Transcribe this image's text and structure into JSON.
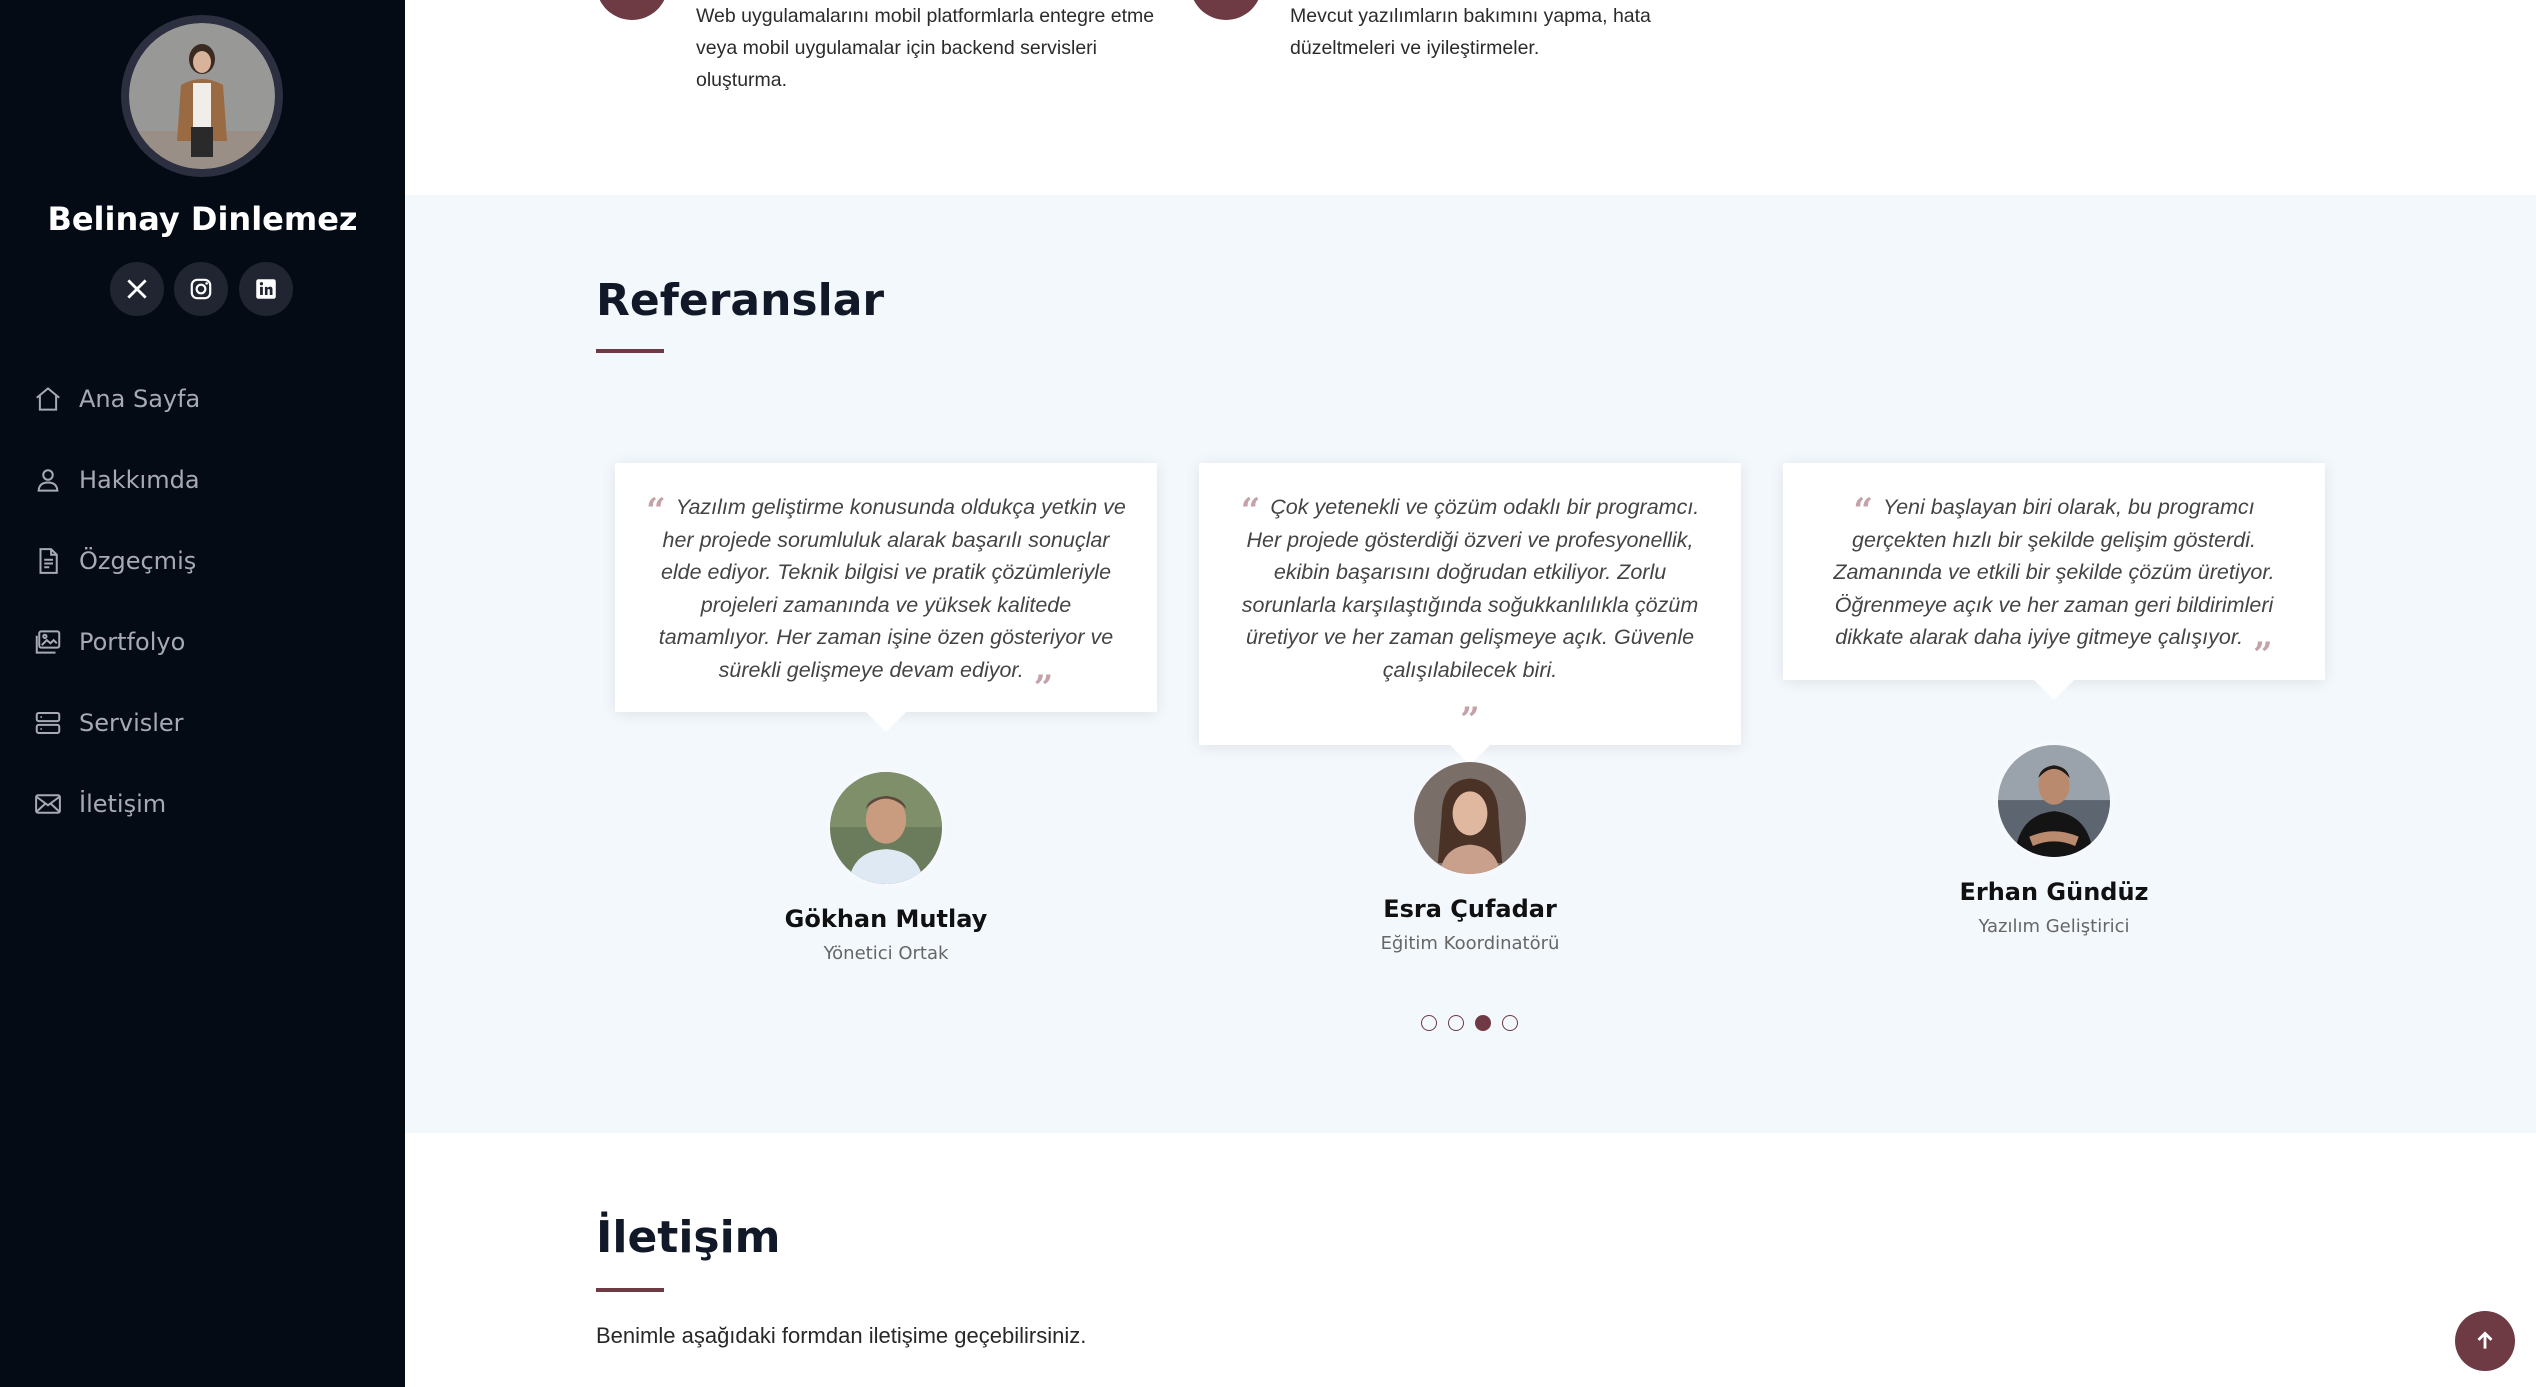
{
  "profile": {
    "name": "Belinay Dinlemez",
    "socials": [
      "twitter-x",
      "instagram",
      "linkedin"
    ]
  },
  "nav": {
    "items": [
      {
        "label": "Ana Sayfa",
        "icon": "house-icon"
      },
      {
        "label": "Hakkımda",
        "icon": "person-icon"
      },
      {
        "label": "Özgeçmiş",
        "icon": "file-icon"
      },
      {
        "label": "Portfolyo",
        "icon": "images-icon"
      },
      {
        "label": "Servisler",
        "icon": "server-icon"
      },
      {
        "label": "İletişim",
        "icon": "envelope-icon"
      }
    ]
  },
  "services": {
    "items": [
      {
        "text": "Web uygulamalarını mobil platformlarla entegre etme veya mobil uygulamalar için backend servisleri oluşturma."
      },
      {
        "text": "Mevcut yazılımların bakımını yapma, hata düzeltmeleri ve iyileştirmeler."
      }
    ]
  },
  "testimonials": {
    "title": "Referanslar",
    "items": [
      {
        "quote": "Yazılım geliştirme konusunda oldukça yetkin ve her projede sorumluluk alarak başarılı sonuçlar elde ediyor. Teknik bilgisi ve pratik çözümleriyle projeleri zamanında ve yüksek kalitede tamamlıyor. Her zaman işine özen gösteriyor ve sürekli gelişmeye devam ediyor.",
        "name": "Gökhan Mutlay",
        "role": "Yönetici Ortak"
      },
      {
        "quote": "Çok yetenekli ve çözüm odaklı bir programcı. Her projede gösterdiği özveri ve profesyonellik, ekibin başarısını doğrudan etkiliyor. Zorlu sorunlarla karşılaştığında soğukkanlılıkla çözüm üretiyor ve her zaman gelişmeye açık. Güvenle çalışılabilecek biri.",
        "name": "Esra Çufadar",
        "role": "Eğitim Koordinatörü"
      },
      {
        "quote": "Yeni başlayan biri olarak, bu programcı gerçekten hızlı bir şekilde gelişim gösterdi. Zamanında ve etkili bir şekilde çözüm üretiyor. Öğrenmeye açık ve her zaman geri bildirimleri dikkate alarak daha iyiye gitmeye çalışıyor.",
        "name": "Erhan Gündüz",
        "role": "Yazılım Geliştirici"
      }
    ],
    "pagination": {
      "total": 4,
      "active": 3
    }
  },
  "contact": {
    "title": "İletişim",
    "text": "Benimle aşağıdaki formdan iletişime geçebilirsiniz."
  },
  "colors": {
    "accent": "#6e3a44",
    "sidebar_bg": "#040b14",
    "section_bg": "#f3f8fd"
  }
}
